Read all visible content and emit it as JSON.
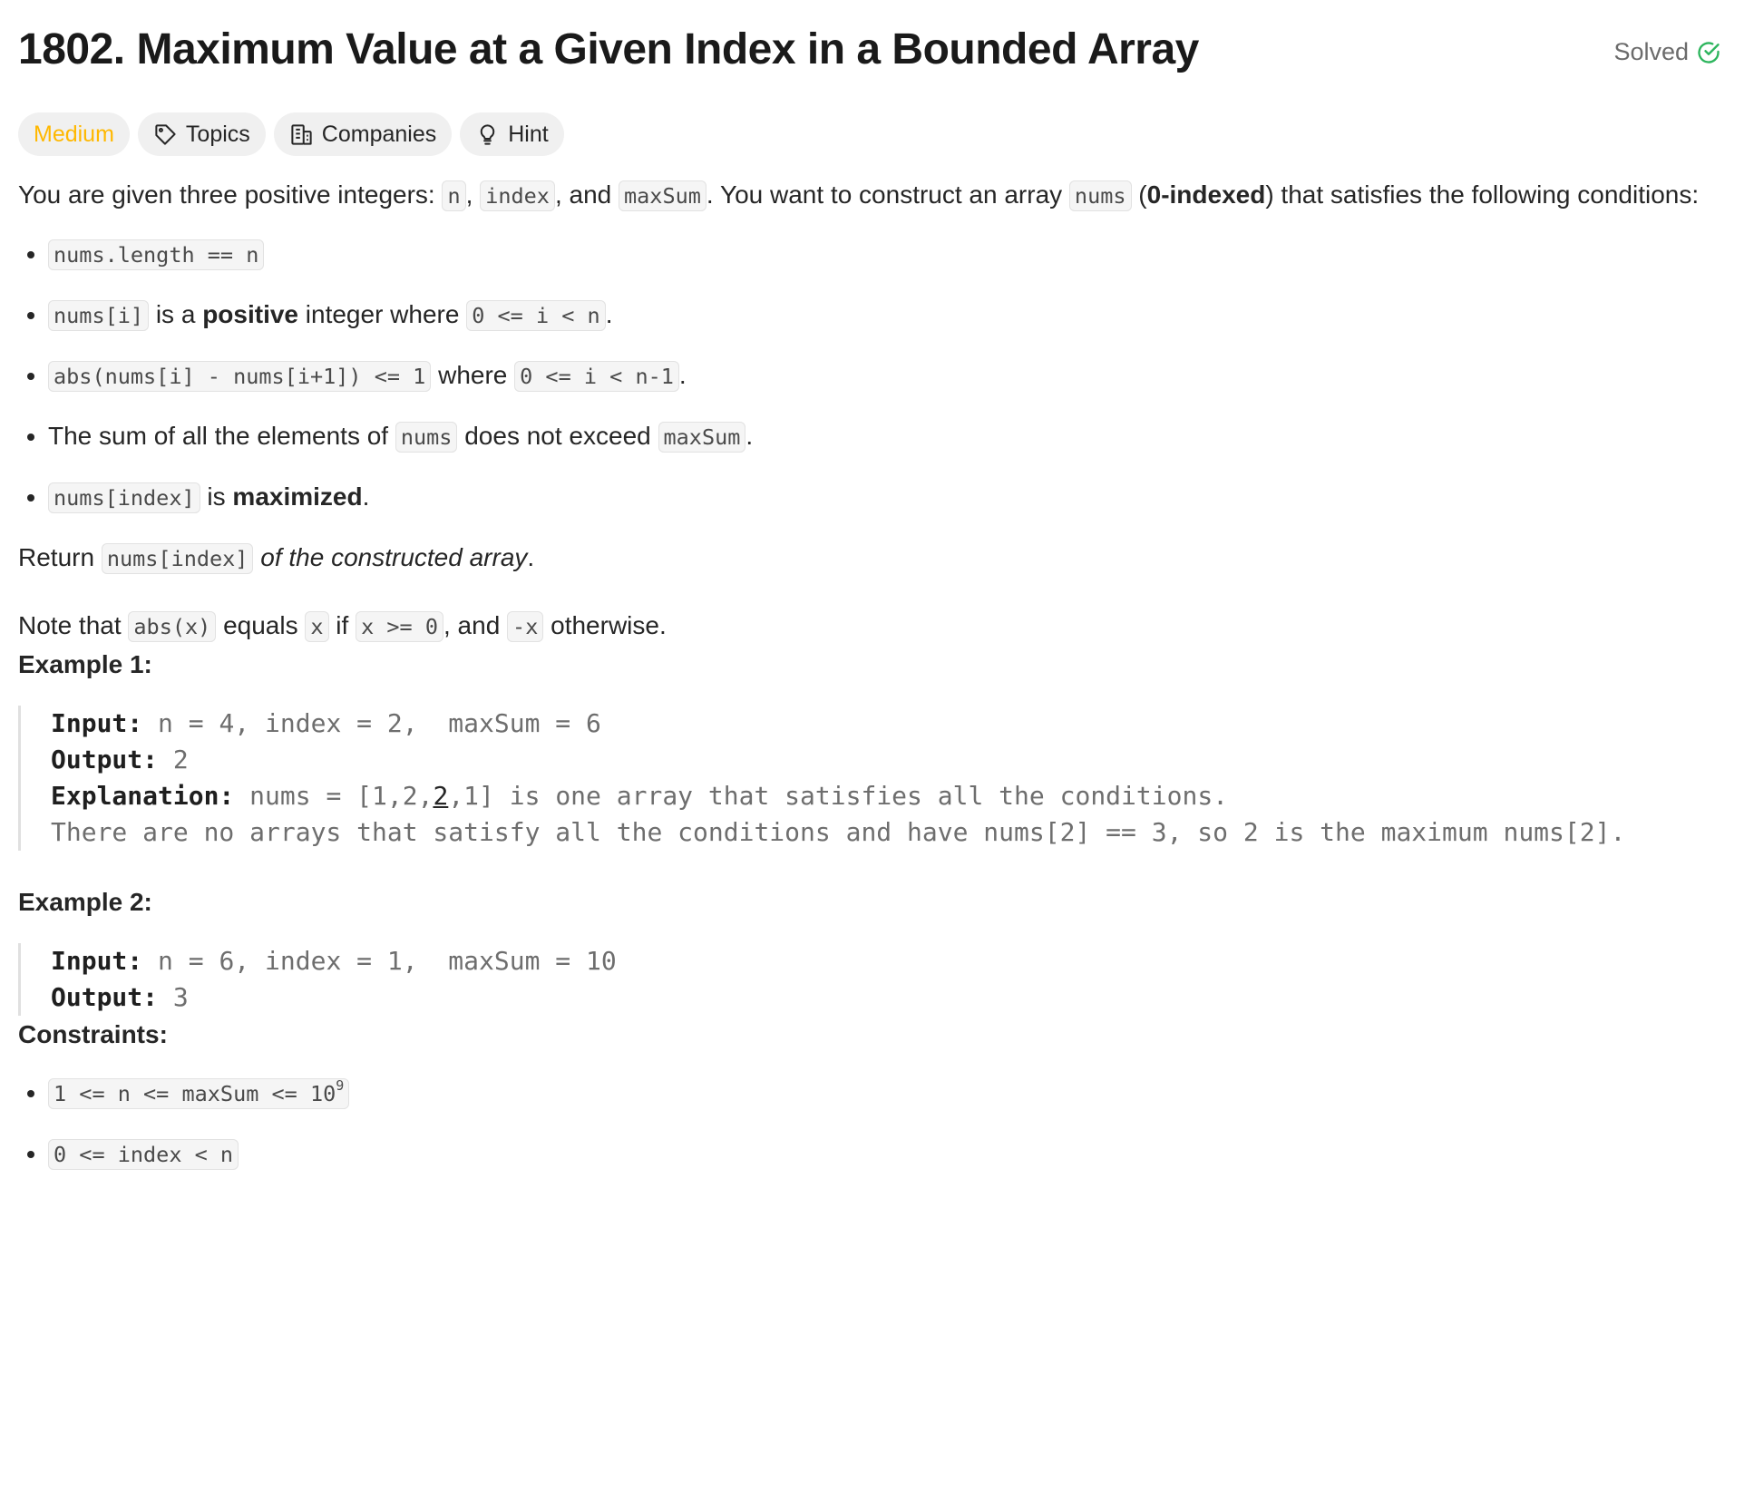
{
  "problem": {
    "title": "1802. Maximum Value at a Given Index in a Bounded Array",
    "status": "Solved"
  },
  "tags": {
    "difficulty": "Medium",
    "topics": "Topics",
    "companies": "Companies",
    "hint": "Hint"
  },
  "intro": {
    "t1": "You are given three positive integers: ",
    "c1": "n",
    "t2": ", ",
    "c2": "index",
    "t3": ", and ",
    "c3": "maxSum",
    "t4": ". You want to construct an array ",
    "c4": "nums",
    "t5": " (",
    "b1": "0-indexed",
    "t6": ") that satisfies the following conditions:"
  },
  "conditions": {
    "c1_code": "nums.length == n",
    "c2_code": "nums[i]",
    "c2_t1": " is a ",
    "c2_bold": "positive",
    "c2_t2": " integer where ",
    "c2_code2": "0 <= i < n",
    "c2_t3": ".",
    "c3_code": "abs(nums[i] - nums[i+1]) <= 1",
    "c3_t1": " where ",
    "c3_code2": "0 <= i < n-1",
    "c3_t2": ".",
    "c4_t1": "The sum of all the elements of ",
    "c4_code": "nums",
    "c4_t2": " does not exceed ",
    "c4_code2": "maxSum",
    "c4_t3": ".",
    "c5_code": "nums[index]",
    "c5_t1": " is ",
    "c5_bold": "maximized",
    "c5_t2": "."
  },
  "return_line": {
    "t1": "Return ",
    "code": "nums[index]",
    "italic": "of the constructed array",
    "t2": "."
  },
  "note": {
    "t1": "Note that ",
    "c1": "abs(x)",
    "t2": " equals ",
    "c2": "x",
    "t3": " if ",
    "c3": "x >= 0",
    "t4": ", and ",
    "c4": "-x",
    "t5": " otherwise."
  },
  "examples": [
    {
      "title": "Example 1:",
      "input_label": "Input:",
      "input": " n = 4, index = 2,  maxSum = 6",
      "output_label": "Output:",
      "output": " 2",
      "explanation_label": "Explanation:",
      "exp_pre": " nums = [1,2,",
      "exp_under": "2",
      "exp_post": ",1] is one array that satisfies all the conditions.",
      "exp_line2": "There are no arrays that satisfy all the conditions and have nums[2] == 3, so 2 is the maximum nums[2]."
    },
    {
      "title": "Example 2:",
      "input_label": "Input:",
      "input": " n = 6, index = 1,  maxSum = 10",
      "output_label": "Output:",
      "output": " 3"
    }
  ],
  "constraints": {
    "title": "Constraints:",
    "c1_code": "1 <= n <= maxSum <= 10",
    "c1_sup": "9",
    "c2_code": "0 <= index < n"
  },
  "colors": {
    "medium": "#ffb800",
    "solved_check": "#2db55d"
  }
}
